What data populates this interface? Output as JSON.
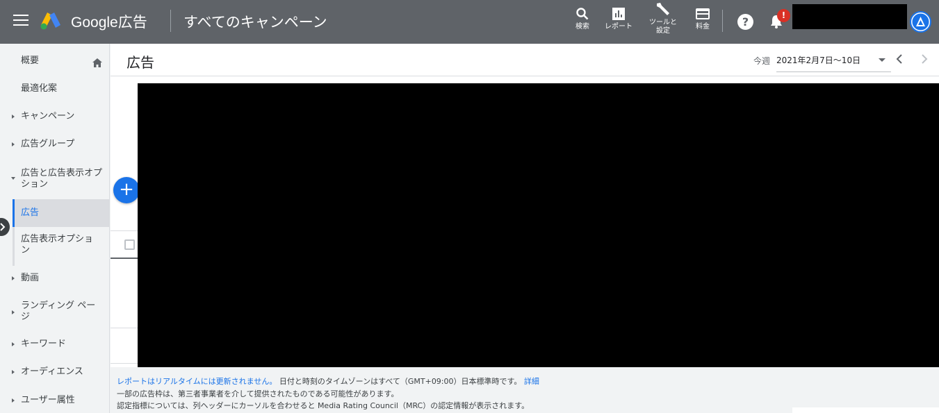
{
  "topbar": {
    "product_name": "Google広告",
    "breadcrumb": "すべてのキャンペーン",
    "tools": {
      "search_label": "検索",
      "report_label": "レポート",
      "tools_label_1": "ツールと",
      "tools_label_2": "設定",
      "billing_label": "料金"
    },
    "help_symbol": "?",
    "notification_badge": "!"
  },
  "sidebar": {
    "items": [
      {
        "label": "概要"
      },
      {
        "label": "最適化案"
      },
      {
        "label": "キャンペーン"
      },
      {
        "label": "広告グループ"
      },
      {
        "label": "広告と広告表示オプション"
      },
      {
        "label": "広告"
      },
      {
        "label": "広告表示オプション"
      },
      {
        "label": "動画"
      },
      {
        "label": "ランディング ページ"
      },
      {
        "label": "キーワード"
      },
      {
        "label": "オーディエンス"
      },
      {
        "label": "ユーザー属性"
      }
    ]
  },
  "main": {
    "page_title": "広告",
    "date_prefix": "今週",
    "date_range": "2021年2月7日～10日",
    "add_button": "+"
  },
  "footer": {
    "realtime_link": "レポートはリアルタイムには更新されません。",
    "timezone_text": "日付と時刻のタイムゾーンはすべて（GMT+09:00）日本標準時です。",
    "details_link": "詳細",
    "line2": "一部の広告枠は、第三者事業者を介して提供されたものである可能性があります。",
    "line3": "認定指標については、列ヘッダーにカーソルを合わせると Media Rating Council（MRC）の認定情報が表示されます。"
  },
  "colors": {
    "topbar": "#5f6368",
    "accent": "#1a73e8",
    "badge": "#d93025"
  }
}
